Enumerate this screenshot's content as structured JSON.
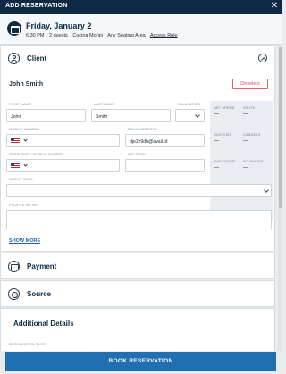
{
  "header": {
    "title": "ADD RESERVATION",
    "close_glyph": "✕"
  },
  "summary": {
    "date": "Friday, January 2",
    "time": "6:30 PM",
    "guests": "2 guests",
    "restaurant": "Cucina Morini",
    "seating": "Any Seating Area",
    "access_rule": "Access Rule"
  },
  "client": {
    "section_title": "Client",
    "name": "John Smith",
    "deselect_label": "Deselect",
    "fields": {
      "first_name_label": "FIRST NAME",
      "first_name": "John",
      "last_name_label": "LAST NAME",
      "last_name": "Smith",
      "salutation_label": "SALUTATION",
      "salutation": "",
      "mobile_label": "MOBILE NUMBER",
      "mobile": "",
      "email_label": "EMAIL ADDRESS",
      "email": "dje2z9dh@avail.id",
      "secondary_mobile_label": "SECONDARY MOBILE NUMBER",
      "secondary_mobile": "",
      "alt_email_label": "ALT EMAIL",
      "alt_email": "",
      "client_tags_label": "CLIENT TAGS",
      "profile_notes_label": "PROFILE NOTES"
    },
    "stats": [
      {
        "label": "NET SPEND",
        "value": "—"
      },
      {
        "label": "VISITS",
        "value": "—"
      },
      {
        "label": "AVG/VISIT",
        "value": "—"
      },
      {
        "label": "CANCELS",
        "value": "—"
      },
      {
        "label": "AVG/COVER",
        "value": "—"
      },
      {
        "label": "NO SHOWS",
        "value": "—"
      }
    ],
    "show_more": "SHOW MORE"
  },
  "payment": {
    "section_title": "Payment"
  },
  "source": {
    "section_title": "Source"
  },
  "details": {
    "section_title": "Additional Details",
    "reservation_tags_label": "RESERVATION TAGS"
  },
  "footer": {
    "book_label": "BOOK RESERVATION"
  },
  "colors": {
    "nav": "#0f2a44",
    "primary": "#1f6fb2",
    "danger": "#d14b55",
    "stats_bg": "#e9edf1"
  }
}
